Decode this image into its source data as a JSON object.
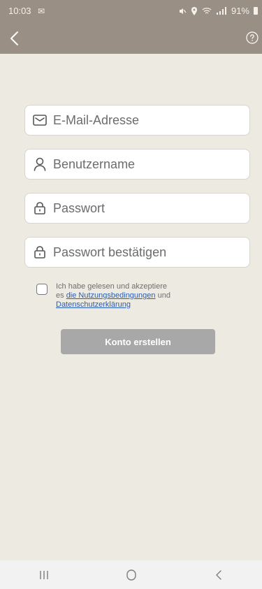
{
  "status_bar": {
    "time": "10:03",
    "notification_glyph": "✉",
    "battery": "91%"
  },
  "form": {
    "email_placeholder": "E-Mail-Adresse",
    "username_placeholder": "Benutzername",
    "password_placeholder": "Passwort",
    "password_confirm_placeholder": "Passwort bestätigen"
  },
  "agreement": {
    "text_1": "Ich habe gelesen und akzeptiere",
    "text_2": "es",
    "link_terms": "die Nutzungsbedingungen",
    "text_and": "und",
    "link_privacy": "Datenschutzerklärung"
  },
  "buttons": {
    "create_account": "Konto erstellen"
  },
  "icons": {
    "back": "chevron-left-icon",
    "help": "help-circle-icon",
    "email": "mail-icon",
    "user": "user-icon",
    "lock": "lock-icon",
    "nav_recent": "recent-apps-icon",
    "nav_home": "home-icon",
    "nav_back": "back-icon"
  },
  "colors": {
    "header": "#9a8f84",
    "background": "#edeae2",
    "button_disabled": "#a8a8a8",
    "link": "#2a5db0"
  }
}
